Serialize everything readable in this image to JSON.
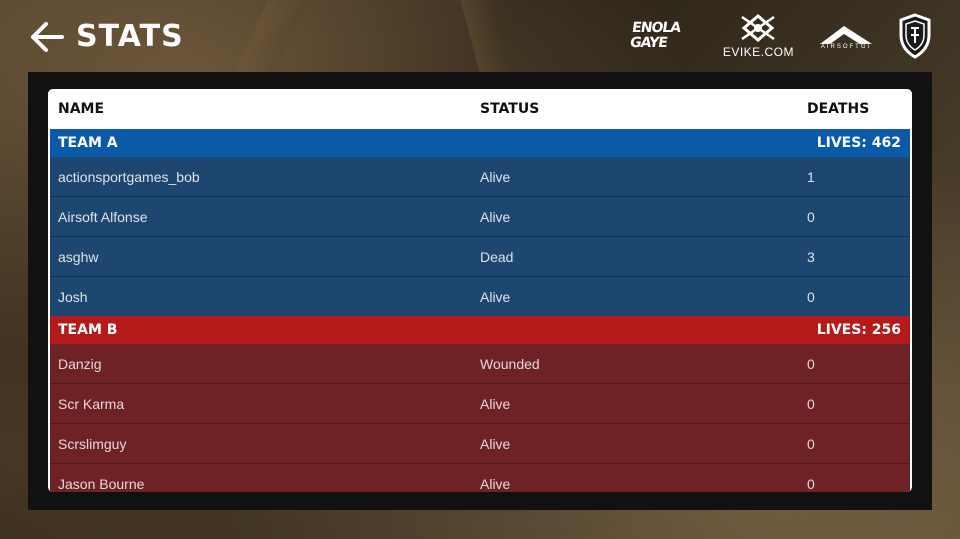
{
  "header": {
    "title": "STATS",
    "back_icon": "arrow-left-icon"
  },
  "logos": {
    "enola_gaye": "ENOLA GAYE",
    "evike": "EVIKE.COM",
    "airsoftgi": "AIRSOFTGI"
  },
  "columns": {
    "name": "NAME",
    "status": "STATUS",
    "deaths": "DEATHS"
  },
  "teams": [
    {
      "name": "TEAM A",
      "lives_label": "LIVES: 462",
      "color": "#0b5aa8",
      "players": [
        {
          "name": "actionsportgames_bob",
          "status": "Alive",
          "deaths": "1"
        },
        {
          "name": "Airsoft Alfonse",
          "status": "Alive",
          "deaths": "0"
        },
        {
          "name": "asghw",
          "status": "Dead",
          "deaths": "3"
        },
        {
          "name": "Josh",
          "status": "Alive",
          "deaths": "0"
        }
      ]
    },
    {
      "name": "TEAM B",
      "lives_label": "LIVES: 256",
      "color": "#b41a1a",
      "players": [
        {
          "name": "Danzig",
          "status": "Wounded",
          "deaths": "0"
        },
        {
          "name": "Scr Karma",
          "status": "Alive",
          "deaths": "0"
        },
        {
          "name": "Scrslimguy",
          "status": "Alive",
          "deaths": "0"
        },
        {
          "name": "Jason Bourne",
          "status": "Alive",
          "deaths": "0"
        }
      ]
    }
  ]
}
